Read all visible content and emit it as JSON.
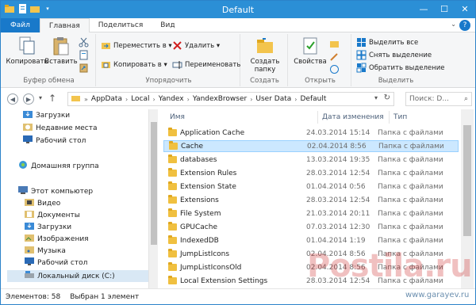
{
  "window": {
    "title": "Default",
    "minimize": "—",
    "maximize": "☐",
    "close": "✕"
  },
  "tabs": [
    "Файл",
    "Главная",
    "Поделиться",
    "Вид"
  ],
  "ribbon": {
    "clipboard": {
      "copy": "Копировать",
      "paste": "Вставить",
      "label": "Буфер обмена"
    },
    "organize": {
      "move": "Переместить в ▾",
      "copy_to": "Копировать в ▾",
      "delete": "Удалить ▾",
      "rename": "Переименовать",
      "label": "Упорядочить"
    },
    "create": {
      "new_folder": "Создать папку",
      "label": "Создать"
    },
    "open": {
      "properties": "Свойства",
      "label": "Открыть"
    },
    "select": {
      "select_all": "Выделить все",
      "select_none": "Снять выделение",
      "invert": "Обратить выделение",
      "label": "Выделить"
    }
  },
  "address": {
    "crumbs": [
      "AppData",
      "Local",
      "Yandex",
      "YandexBrowser",
      "User Data",
      "Default"
    ],
    "search_placeholder": "Поиск: D..."
  },
  "nav": [
    {
      "label": "Загрузки",
      "icon": "downloads-icon"
    },
    {
      "label": "Недавние места",
      "icon": "recent-icon"
    },
    {
      "label": "Рабочий стол",
      "icon": "desktop-icon"
    },
    {
      "label": "Домашняя группа",
      "icon": "homegroup-icon"
    },
    {
      "label": "Этот компьютер",
      "icon": "computer-icon"
    },
    {
      "label": "Видео",
      "icon": "video-icon"
    },
    {
      "label": "Документы",
      "icon": "documents-icon"
    },
    {
      "label": "Загрузки",
      "icon": "downloads-icon"
    },
    {
      "label": "Изображения",
      "icon": "pictures-icon"
    },
    {
      "label": "Музыка",
      "icon": "music-icon"
    },
    {
      "label": "Рабочий стол",
      "icon": "desktop-icon"
    },
    {
      "label": "Локальный диск (C:)",
      "icon": "drive-icon"
    }
  ],
  "columns": {
    "name": "Имя",
    "date": "Дата изменения",
    "type": "Тип"
  },
  "files": [
    {
      "name": "Application Cache",
      "date": "24.03.2014 15:14",
      "type": "Папка с файлами"
    },
    {
      "name": "Cache",
      "date": "02.04.2014 8:56",
      "type": "Папка с файлами"
    },
    {
      "name": "databases",
      "date": "13.03.2014 19:35",
      "type": "Папка с файлами"
    },
    {
      "name": "Extension Rules",
      "date": "28.03.2014 12:54",
      "type": "Папка с файлами"
    },
    {
      "name": "Extension State",
      "date": "01.04.2014 0:56",
      "type": "Папка с файлами"
    },
    {
      "name": "Extensions",
      "date": "28.03.2014 12:54",
      "type": "Папка с файлами"
    },
    {
      "name": "File System",
      "date": "21.03.2014 20:11",
      "type": "Папка с файлами"
    },
    {
      "name": "GPUCache",
      "date": "07.03.2014 12:30",
      "type": "Папка с файлами"
    },
    {
      "name": "IndexedDB",
      "date": "01.04.2014 1:19",
      "type": "Папка с файлами"
    },
    {
      "name": "JumpListIcons",
      "date": "02.04.2014 8:56",
      "type": "Папка с файлами"
    },
    {
      "name": "JumpListIconsOld",
      "date": "02.04.2014 8:56",
      "type": "Папка с файлами"
    },
    {
      "name": "Local Extension Settings",
      "date": "28.03.2014 12:54",
      "type": "Папка с файлами"
    }
  ],
  "status": {
    "count": "Элементов: 58",
    "selected": "Выбран 1 элемент"
  },
  "watermark": {
    "main": "Postila.ru",
    "site": "www.garayev.ru"
  },
  "colors": {
    "accent": "#2b8fd6",
    "file_tab": "#1979ca",
    "selection": "#cce8ff"
  }
}
